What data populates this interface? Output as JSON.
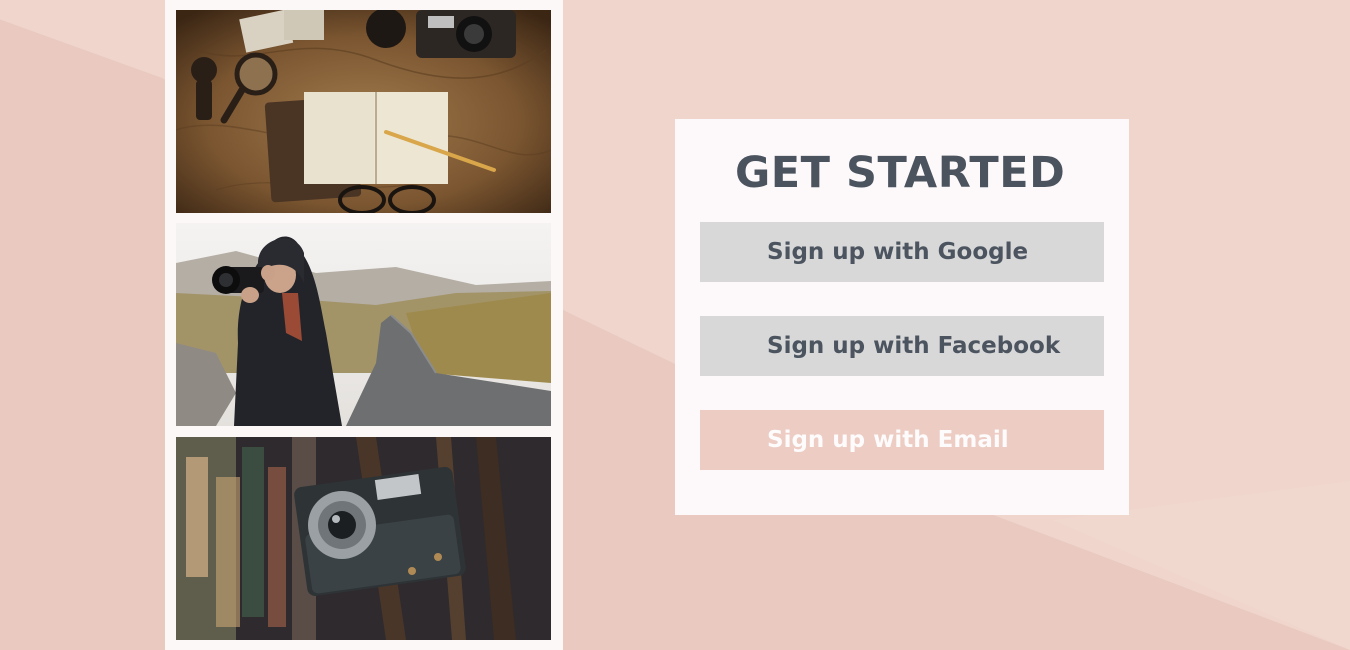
{
  "signup": {
    "title": "GET STARTED",
    "google_label": "Sign up with Google",
    "facebook_label": "Sign up with Facebook",
    "email_label": "Sign up with Email"
  },
  "gallery": {
    "photos": [
      {
        "subject": "travel-flatlay-map-notebook"
      },
      {
        "subject": "photographer-with-camera"
      },
      {
        "subject": "vintage-camera-closeup"
      }
    ]
  },
  "colors": {
    "background": "#ecd0c7",
    "card": "#fdf9fa",
    "title": "#4a535e",
    "social_button": "#d8d8d9",
    "email_button": "#ecccc3",
    "email_text": "#fdfbfb"
  }
}
